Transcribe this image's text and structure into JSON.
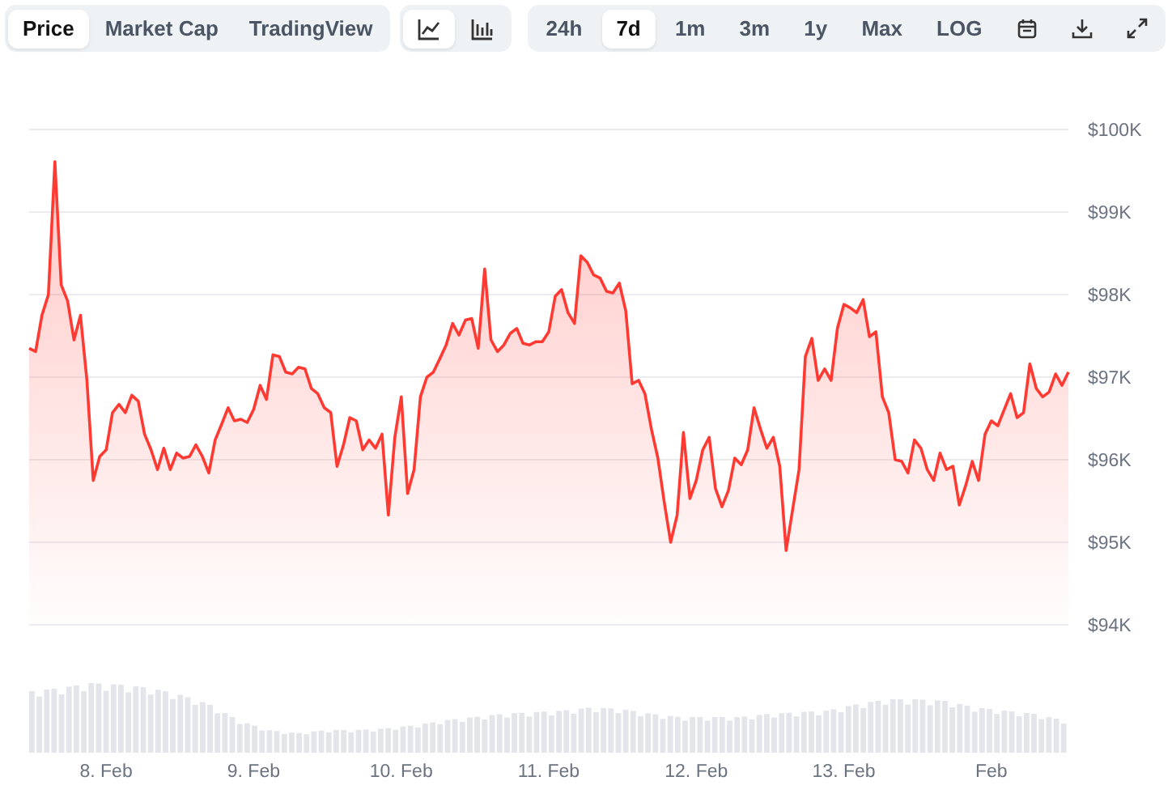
{
  "tabs": [
    {
      "label": "Price",
      "selected": true
    },
    {
      "label": "Market Cap",
      "selected": false
    },
    {
      "label": "TradingView",
      "selected": false
    }
  ],
  "chart_types": [
    {
      "kind": "line",
      "selected": true
    },
    {
      "kind": "bars",
      "selected": false
    }
  ],
  "ranges": [
    {
      "label": "24h",
      "selected": false
    },
    {
      "label": "7d",
      "selected": true
    },
    {
      "label": "1m",
      "selected": false
    },
    {
      "label": "3m",
      "selected": false
    },
    {
      "label": "1y",
      "selected": false
    },
    {
      "label": "Max",
      "selected": false
    },
    {
      "label": "LOG",
      "selected": false
    }
  ],
  "actions": [
    {
      "kind": "calendar"
    },
    {
      "kind": "download"
    },
    {
      "kind": "expand"
    }
  ],
  "chart_data": {
    "type": "area",
    "grid": true,
    "ylim": [
      94,
      100
    ],
    "categories": [
      null,
      null,
      null,
      null,
      null,
      null,
      null,
      null,
      null,
      null,
      null,
      null,
      "8. Feb",
      null,
      null,
      null,
      null,
      null,
      null,
      null,
      null,
      null,
      null,
      null,
      null,
      null,
      null,
      null,
      null,
      null,
      null,
      null,
      null,
      null,
      null,
      "9. Feb",
      null,
      null,
      null,
      null,
      null,
      null,
      null,
      null,
      null,
      null,
      null,
      null,
      null,
      null,
      null,
      null,
      null,
      null,
      null,
      null,
      null,
      null,
      "10. Feb",
      null,
      null,
      null,
      null,
      null,
      null,
      null,
      null,
      null,
      null,
      null,
      null,
      null,
      null,
      null,
      null,
      null,
      null,
      null,
      null,
      null,
      null,
      "11. Feb",
      null,
      null,
      null,
      null,
      null,
      null,
      null,
      null,
      null,
      null,
      null,
      null,
      null,
      null,
      null,
      null,
      null,
      null,
      null,
      null,
      null,
      null,
      "12. Feb",
      null,
      null,
      null,
      null,
      null,
      null,
      null,
      null,
      null,
      null,
      null,
      null,
      null,
      null,
      null,
      null,
      null,
      null,
      null,
      null,
      null,
      null,
      "13. Feb",
      null,
      null,
      null,
      null,
      null,
      null,
      null,
      null,
      null,
      null,
      null,
      null,
      null,
      null,
      null,
      null,
      null,
      null,
      null,
      null,
      null,
      null,
      "Feb",
      null,
      null,
      null,
      null,
      null,
      null,
      null,
      null,
      null,
      null,
      null,
      null
    ],
    "yticks": [
      {
        "value": 100,
        "label": "$100K"
      },
      {
        "value": 99,
        "label": "$99K"
      },
      {
        "value": 98,
        "label": "$98K"
      },
      {
        "value": 97,
        "label": "$97K"
      },
      {
        "value": 96,
        "label": "$96K"
      },
      {
        "value": 95,
        "label": "$95K"
      },
      {
        "value": 94,
        "label": "$94K"
      }
    ],
    "series": [
      {
        "color": "#ff3a33",
        "values": [
          97.35,
          97.31,
          97.75,
          98.0,
          99.61,
          98.12,
          97.92,
          97.45,
          97.75,
          96.96,
          95.75,
          96.04,
          96.12,
          96.57,
          96.67,
          96.57,
          96.78,
          96.71,
          96.31,
          96.12,
          95.88,
          96.14,
          95.88,
          96.08,
          96.02,
          96.04,
          96.18,
          96.04,
          95.84,
          96.24,
          96.43,
          96.63,
          96.47,
          96.49,
          96.45,
          96.61,
          96.9,
          96.73,
          97.27,
          97.25,
          97.06,
          97.04,
          97.12,
          97.1,
          96.86,
          96.8,
          96.63,
          96.57,
          95.92,
          96.18,
          96.51,
          96.47,
          96.12,
          96.24,
          96.14,
          96.31,
          95.33,
          96.27,
          96.76,
          95.59,
          95.88,
          96.76,
          97.0,
          97.06,
          97.22,
          97.39,
          97.65,
          97.51,
          97.69,
          97.71,
          97.35,
          98.31,
          97.45,
          97.31,
          97.39,
          97.53,
          97.59,
          97.41,
          97.39,
          97.43,
          97.43,
          97.55,
          97.98,
          98.06,
          97.78,
          97.65,
          98.47,
          98.39,
          98.24,
          98.2,
          98.04,
          98.02,
          98.14,
          97.8,
          96.92,
          96.96,
          96.8,
          96.37,
          96.02,
          95.49,
          95.0,
          95.33,
          96.33,
          95.53,
          95.75,
          96.12,
          96.27,
          95.65,
          95.43,
          95.63,
          96.02,
          95.94,
          96.12,
          96.63,
          96.37,
          96.14,
          96.27,
          95.92,
          94.9,
          95.39,
          95.88,
          97.25,
          97.47,
          96.96,
          97.1,
          96.96,
          97.59,
          97.88,
          97.84,
          97.78,
          97.94,
          97.49,
          97.55,
          96.76,
          96.57,
          96.0,
          95.98,
          95.84,
          96.24,
          96.14,
          95.88,
          95.75,
          96.08,
          95.88,
          95.92,
          95.45,
          95.69,
          95.98,
          95.75,
          96.31,
          96.47,
          96.41,
          96.61,
          96.8,
          96.51,
          96.57,
          97.16,
          96.86,
          96.76,
          96.82,
          97.04,
          96.9,
          97.06
        ]
      }
    ]
  }
}
